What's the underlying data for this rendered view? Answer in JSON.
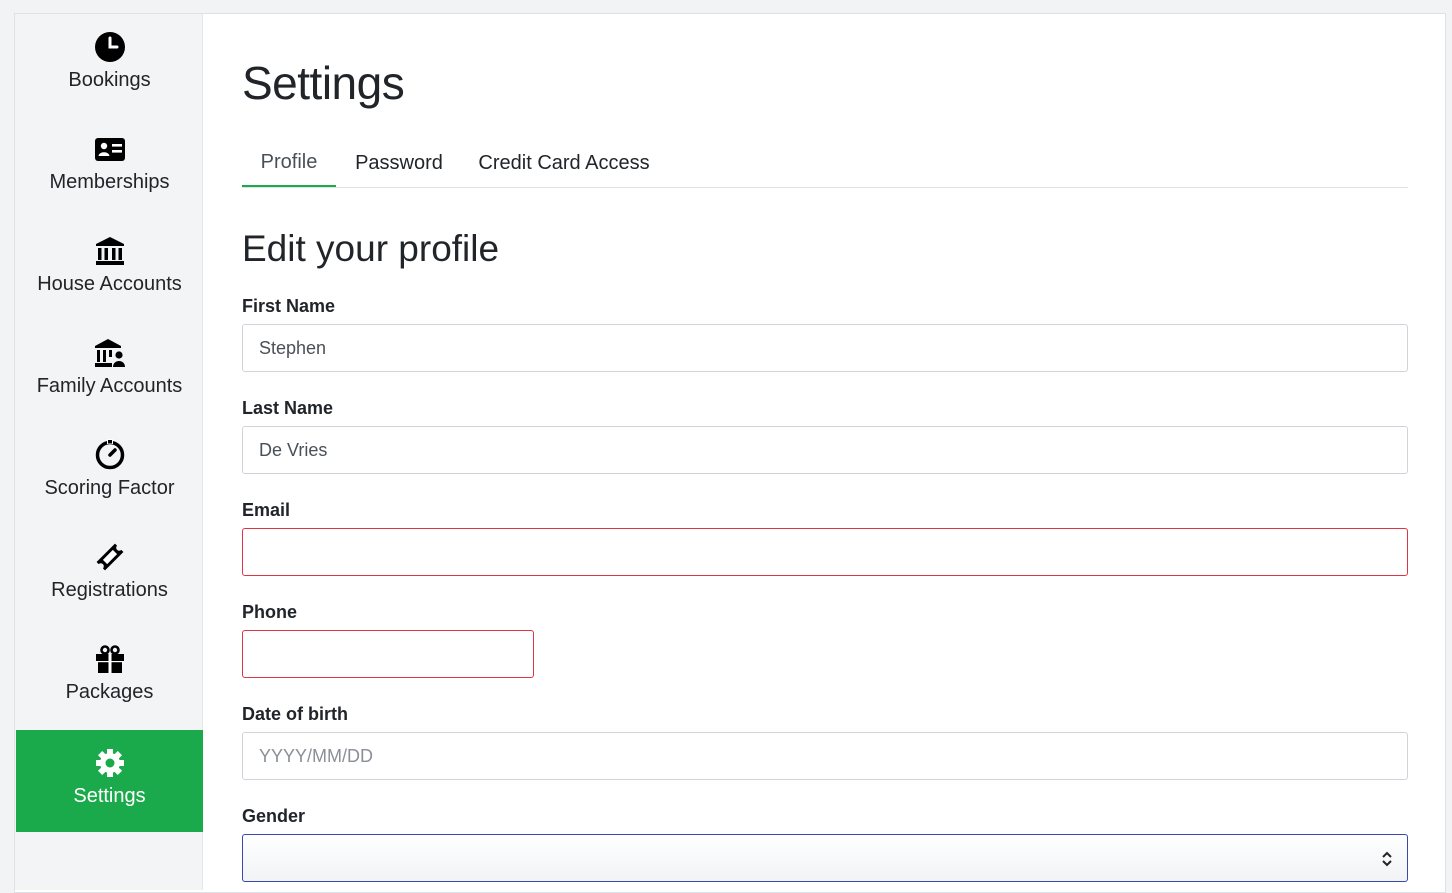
{
  "sidebar": {
    "items": [
      {
        "label": "Bookings",
        "icon": "clock-icon"
      },
      {
        "label": "Memberships",
        "icon": "id-card-icon"
      },
      {
        "label": "House Accounts",
        "icon": "bank-icon"
      },
      {
        "label": "Family Accounts",
        "icon": "bank-user-icon"
      },
      {
        "label": "Scoring Factor",
        "icon": "gauge-icon"
      },
      {
        "label": "Registrations",
        "icon": "ticket-icon"
      },
      {
        "label": "Packages",
        "icon": "gift-icon"
      },
      {
        "label": "Settings",
        "icon": "gear-icon",
        "active": true
      }
    ],
    "active_color": "#1aaa4b"
  },
  "page": {
    "title": "Settings"
  },
  "tabs": [
    {
      "label": "Profile",
      "active": true
    },
    {
      "label": "Password"
    },
    {
      "label": "Credit Card Access"
    }
  ],
  "form": {
    "title": "Edit your profile",
    "first_name": {
      "label": "First Name",
      "value": "Stephen"
    },
    "last_name": {
      "label": "Last Name",
      "value": "De Vries"
    },
    "email": {
      "label": "Email",
      "value": ""
    },
    "phone": {
      "label": "Phone",
      "value": ""
    },
    "dob": {
      "label": "Date of birth",
      "value": "",
      "placeholder": "YYYY/MM/DD"
    },
    "gender": {
      "label": "Gender",
      "value": ""
    }
  }
}
